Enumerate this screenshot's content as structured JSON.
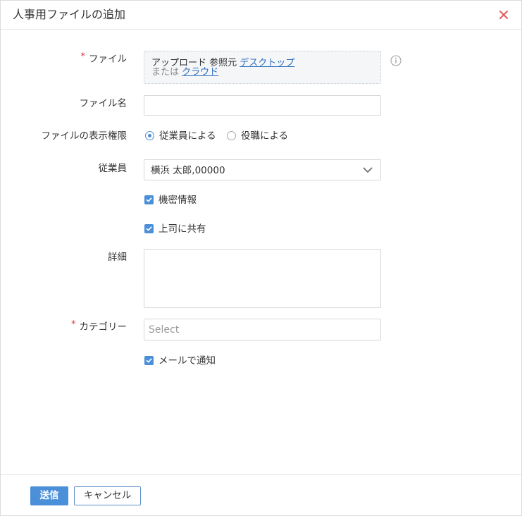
{
  "dialog": {
    "title": "人事用ファイルの追加"
  },
  "form": {
    "file": {
      "required_mark": "*",
      "label": "ファイル",
      "upload_label": "アップロード 参照元",
      "desktop_link": "デスクトップ",
      "or_label": "または",
      "cloud_link": "クラウド"
    },
    "file_name": {
      "label": "ファイル名",
      "value": ""
    },
    "visibility": {
      "label": "ファイルの表示権限",
      "options": [
        {
          "label": "従業員による",
          "selected": true
        },
        {
          "label": "役職による",
          "selected": false
        }
      ]
    },
    "employee": {
      "label": "従業員",
      "value": "横浜 太郎,00000"
    },
    "confidential": {
      "label": "機密情報",
      "checked": true
    },
    "share_manager": {
      "label": "上司に共有",
      "checked": true
    },
    "details": {
      "label": "詳細",
      "value": ""
    },
    "category": {
      "required_mark": "*",
      "label": "カテゴリー",
      "placeholder": "Select"
    },
    "notify_email": {
      "label": "メールで通知",
      "checked": true
    }
  },
  "footer": {
    "submit_label": "送信",
    "cancel_label": "キャンセル"
  },
  "icons": {
    "close": "close-icon",
    "info": "info-icon",
    "select_arrow": "chevron-down-icon",
    "check": "check-icon"
  },
  "colors": {
    "accent": "#4a8fd8",
    "link": "#2f6fc0",
    "required": "#e03c3c",
    "close": "#e05a5a"
  }
}
